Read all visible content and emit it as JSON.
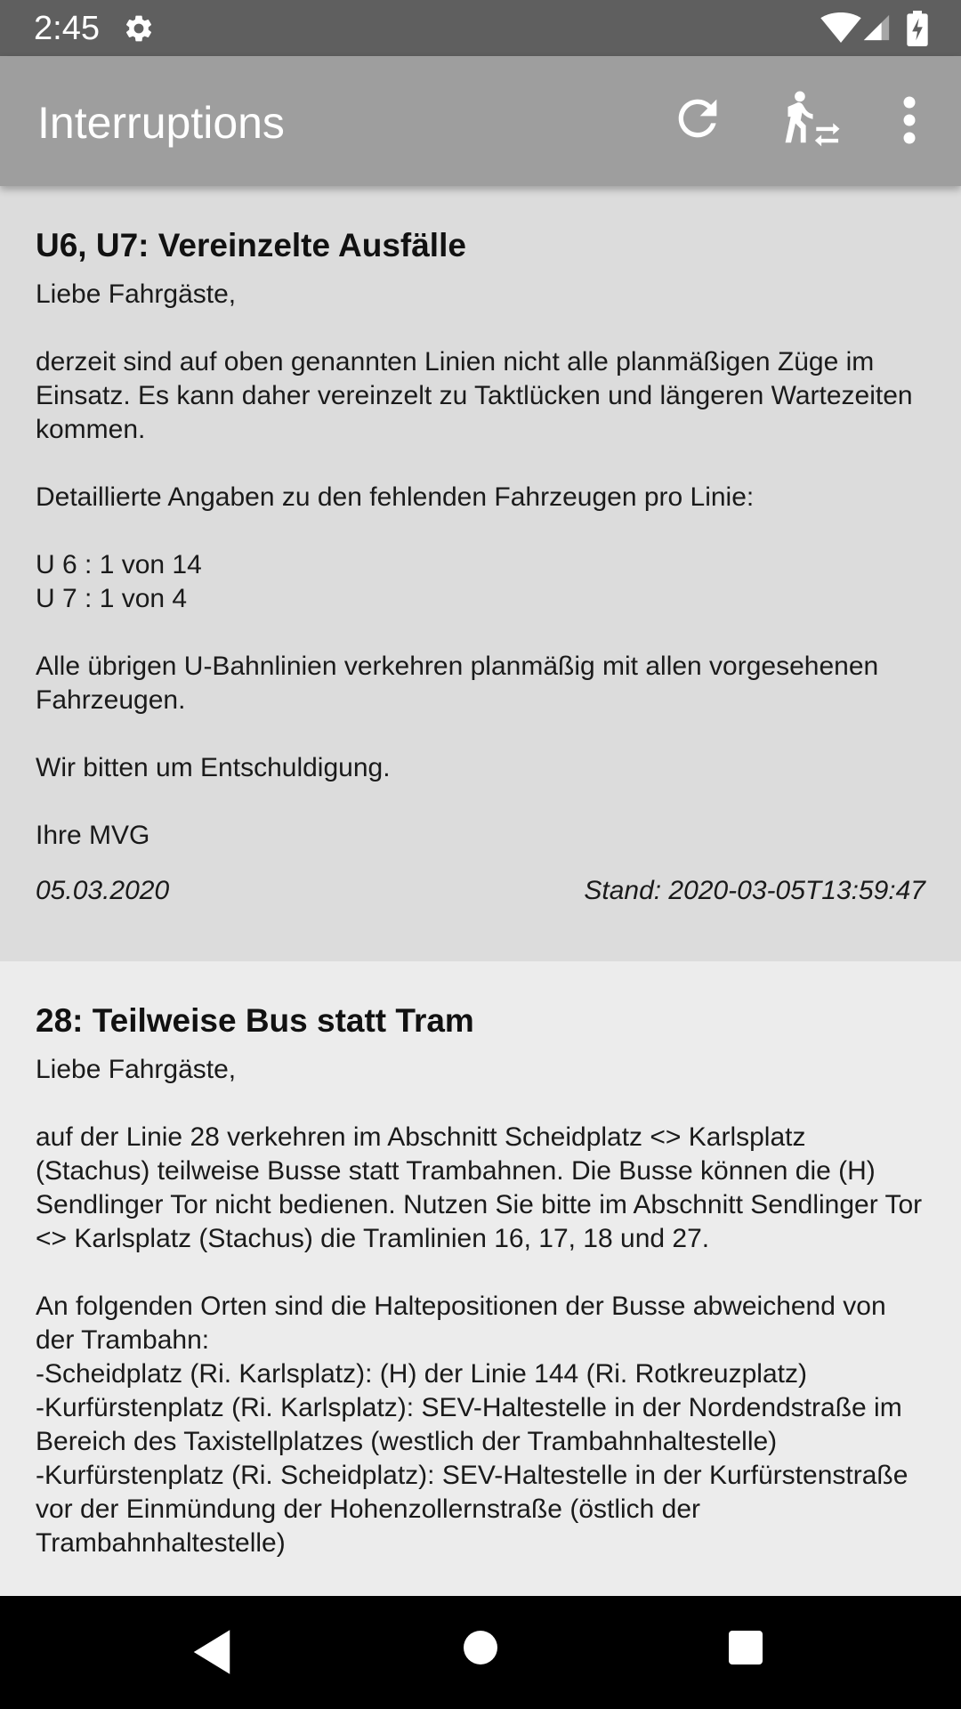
{
  "status_bar": {
    "time": "2:45",
    "icons": [
      "gear-icon",
      "wifi-icon",
      "signal-icon",
      "battery-charging-icon"
    ]
  },
  "app_bar": {
    "title": "Interruptions",
    "actions": [
      "refresh-icon",
      "walk-transfer-icon",
      "more-vert-icon"
    ]
  },
  "interruptions": [
    {
      "title": "U6, U7: Vereinzelte Ausfälle",
      "body": "Liebe Fahrgäste,\n\nderzeit sind auf oben genannten Linien nicht alle planmäßigen Züge im Einsatz. Es kann daher vereinzelt zu Taktlücken und längeren Wartezeiten kommen.\n\nDetaillierte Angaben zu den fehlenden Fahrzeugen pro Linie:\n\nU 6 : 1 von 14\nU 7 : 1 von 4\n\nAlle übrigen U-Bahnlinien verkehren planmäßig mit allen vorgesehenen Fahrzeugen.\n\nWir bitten um Entschuldigung.\n\nIhre MVG",
      "date": "05.03.2020",
      "stand": "Stand: 2020-03-05T13:59:47"
    },
    {
      "title": "28: Teilweise Bus statt Tram",
      "body": "Liebe Fahrgäste,\n\nauf der Linie 28 verkehren im Abschnitt Scheidplatz <> Karlsplatz (Stachus) teilweise Busse statt Trambahnen. Die Busse können die (H) Sendlinger Tor nicht bedienen. Nutzen Sie bitte im Abschnitt Sendlinger Tor <> Karlsplatz (Stachus) die Tramlinien 16, 17, 18 und 27.\n\nAn folgenden Orten sind die Haltepositionen der Busse abweichend von der Trambahn:\n-Scheidplatz (Ri. Karlsplatz): (H) der Linie 144 (Ri. Rotkreuzplatz)\n-Kurfürstenplatz (Ri. Karlsplatz): SEV-Haltestelle in der Nordendstraße im Bereich des Taxistellplatzes (westlich der Trambahnhaltestelle)\n-Kurfürstenplatz (Ri. Scheidplatz): SEV-Haltestelle in der Kurfürstenstraße vor der Einmündung der Hohenzollernstraße (östlich der Trambahnhaltestelle)"
    }
  ],
  "nav_bar": {
    "buttons": [
      "back-icon",
      "home-icon",
      "recents-icon"
    ]
  }
}
